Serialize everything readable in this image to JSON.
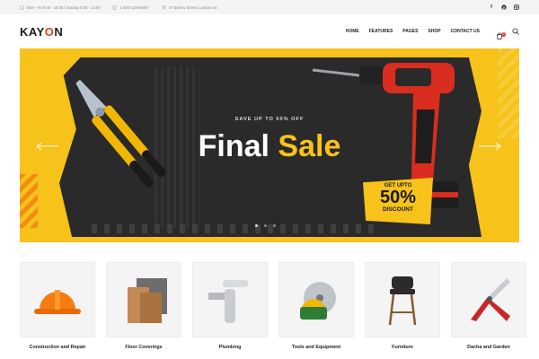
{
  "topbar": {
    "hours": "Mon - Fri 9:00 - 18:00  /  Sunday 8:00 - 14:00",
    "phone": "1-800-123-56587",
    "address": "47 Bakery Street, London UK",
    "social": [
      "f",
      "p",
      "ig"
    ]
  },
  "header": {
    "logo_start": "KAY",
    "logo_o": "O",
    "logo_end": "N",
    "nav": [
      "HOME",
      "FEATURES",
      "PAGES",
      "SHOP",
      "CONTACT US"
    ],
    "cart_count": "0"
  },
  "hero": {
    "subtitle": "SAVE UP TO 50% OFF",
    "title_white": "Final",
    "title_yellow": "Sale",
    "badge_top": "GET UPTO",
    "badge_value": "50%",
    "badge_bottom": "DISCOUNT",
    "slides": 3,
    "active_slide": 1,
    "colors": {
      "yellow": "#f7c21a",
      "dark": "#2a2a2a",
      "accent": "#e03a2f"
    }
  },
  "categories": [
    {
      "label": "Construction and Repair",
      "icon": "hard-hat-icon"
    },
    {
      "label": "Floor Coverings",
      "icon": "floor-tiles-icon"
    },
    {
      "label": "Plumbing",
      "icon": "faucet-icon"
    },
    {
      "label": "Tools and Equipment",
      "icon": "saw-blade-icon"
    },
    {
      "label": "Furniture",
      "icon": "bar-stool-icon"
    },
    {
      "label": "Dacha and Garden",
      "icon": "pruner-icon"
    }
  ]
}
